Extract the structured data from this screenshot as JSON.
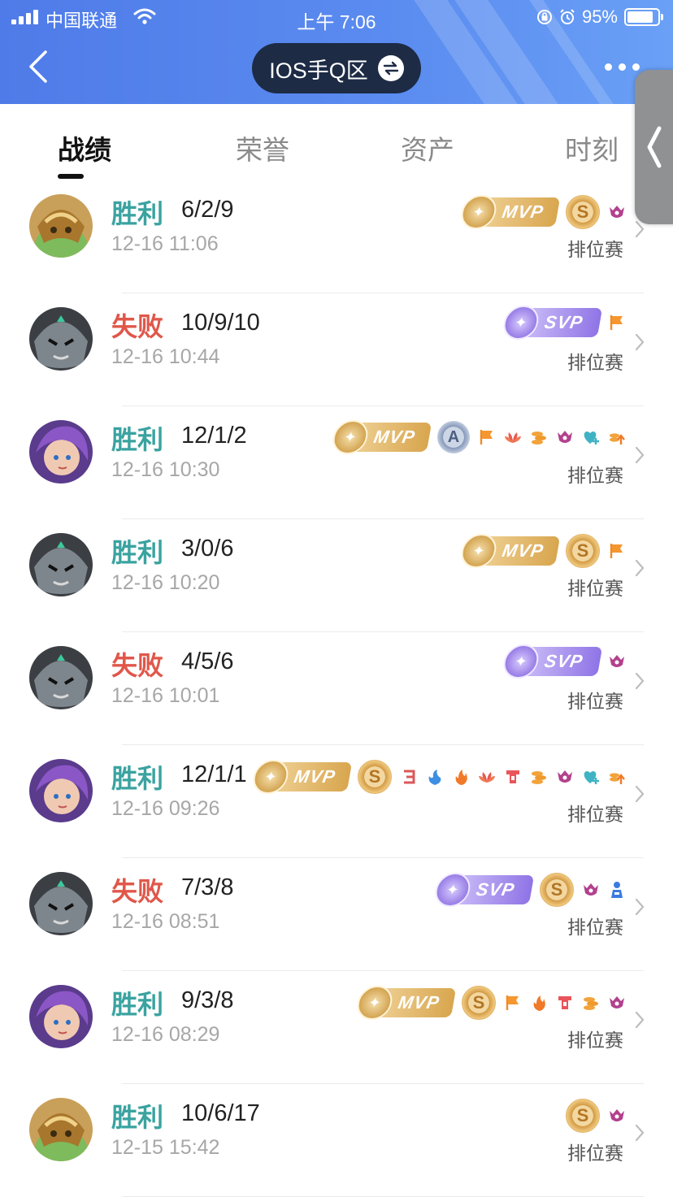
{
  "status_bar": {
    "carrier": "中国联通",
    "time": "上午 7:06",
    "battery": "95%"
  },
  "header": {
    "zone_label": "IOS手Q区"
  },
  "tabs": [
    {
      "label": "战绩",
      "active": true
    },
    {
      "label": "荣誉",
      "active": false
    },
    {
      "label": "资产",
      "active": false
    },
    {
      "label": "时刻",
      "active": false
    }
  ],
  "colors": {
    "win": "#3aa3a0",
    "lose": "#e0574a",
    "header_blue": "#4f7be8",
    "mvp_gold": "#d8a64e",
    "svp_purple": "#8f74e6"
  },
  "matches": [
    {
      "result": "胜利",
      "outcome": "win",
      "kda": "6/2/9",
      "time": "12-16 11:06",
      "mode": "排位赛",
      "hero_avatar": "hero-bronze-helmet",
      "badges": [
        "mvp",
        "s-coin",
        "purple-crest-icon"
      ]
    },
    {
      "result": "失败",
      "outcome": "lose",
      "kda": "10/9/10",
      "time": "12-16 10:44",
      "mode": "排位赛",
      "hero_avatar": "hero-steel-helmet",
      "badges": [
        "svp",
        "flag-icon"
      ]
    },
    {
      "result": "胜利",
      "outcome": "win",
      "kda": "12/1/2",
      "time": "12-16 10:30",
      "mode": "排位赛",
      "hero_avatar": "hero-purple-hair",
      "badges": [
        "mvp",
        "a-coin",
        "flag-icon",
        "lotus-icon",
        "coins-icon",
        "purple-crest-icon",
        "heart-plus-icon",
        "coins-up-icon"
      ]
    },
    {
      "result": "胜利",
      "outcome": "win",
      "kda": "3/0/6",
      "time": "12-16 10:20",
      "mode": "排位赛",
      "hero_avatar": "hero-steel-helmet",
      "badges": [
        "mvp",
        "s-coin",
        "flag-icon"
      ]
    },
    {
      "result": "失败",
      "outcome": "lose",
      "kda": "4/5/6",
      "time": "12-16 10:01",
      "mode": "排位赛",
      "hero_avatar": "hero-steel-helmet",
      "badges": [
        "svp",
        "purple-crest-icon"
      ]
    },
    {
      "result": "胜利",
      "outcome": "win",
      "kda": "12/1/1",
      "time": "12-16 09:26",
      "mode": "排位赛",
      "hero_avatar": "hero-purple-hair",
      "badges": [
        "mvp",
        "s-coin",
        "triple-kill-icon",
        "blue-flame-icon",
        "fire-icon",
        "lotus-icon",
        "tower-icon",
        "coins-icon",
        "purple-crest-icon",
        "heart-plus-icon",
        "coins-up-icon"
      ]
    },
    {
      "result": "失败",
      "outcome": "lose",
      "kda": "7/3/8",
      "time": "12-16 08:51",
      "mode": "排位赛",
      "hero_avatar": "hero-steel-helmet",
      "badges": [
        "svp",
        "s-coin",
        "purple-crest-icon",
        "blue-figure-icon"
      ]
    },
    {
      "result": "胜利",
      "outcome": "win",
      "kda": "9/3/8",
      "time": "12-16 08:29",
      "mode": "排位赛",
      "hero_avatar": "hero-purple-hair",
      "badges": [
        "mvp",
        "s-coin",
        "flag-icon",
        "fire-icon",
        "tower-icon",
        "coins-icon",
        "purple-crest-icon"
      ]
    },
    {
      "result": "胜利",
      "outcome": "win",
      "kda": "10/6/17",
      "time": "12-15 15:42",
      "mode": "排位赛",
      "hero_avatar": "hero-bronze-helmet",
      "badges": [
        "s-coin",
        "purple-crest-icon"
      ]
    }
  ],
  "badge_labels": {
    "mvp": "MVP",
    "svp": "SVP",
    "s_coin": "S",
    "a_coin": "A"
  }
}
